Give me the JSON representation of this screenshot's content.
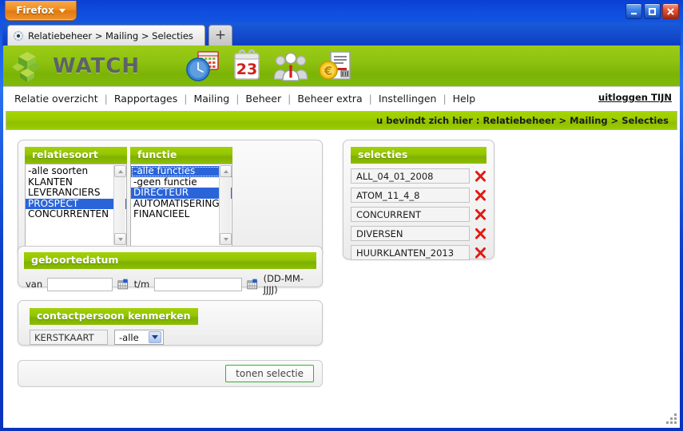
{
  "window": {
    "firefox_button": "Firefox",
    "minimize_label": "Minimize",
    "maximize_label": "Maximize",
    "close_label": "Close"
  },
  "browser": {
    "tab_title": "Relatiebeheer > Mailing > Selecties",
    "new_tab_label": "+"
  },
  "site": {
    "logo_text": "WATCH",
    "header_icons": [
      {
        "name": "clock-calendar-icon"
      },
      {
        "name": "calendar-23-icon"
      },
      {
        "name": "people-group-icon"
      },
      {
        "name": "euro-invoice-icon"
      }
    ]
  },
  "nav": {
    "items": [
      "Relatie overzicht",
      "Rapportages",
      "Mailing",
      "Beheer",
      "Beheer extra",
      "Instellingen",
      "Help"
    ],
    "separator": "|",
    "logout": "uitloggen TIJN"
  },
  "breadcrumb": {
    "text": "u bevindt zich hier : Relatiebeheer > Mailing > Selecties"
  },
  "filters": {
    "relatiesoort": {
      "title": "relatiesoort",
      "options": [
        {
          "label": "-alle soorten",
          "selected": false
        },
        {
          "label": "KLANTEN",
          "selected": false
        },
        {
          "label": "LEVERANCIERS",
          "selected": false
        },
        {
          "label": "PROSPECT",
          "selected": true
        },
        {
          "label": "CONCURRENTEN",
          "selected": false
        }
      ]
    },
    "functie": {
      "title": "functie",
      "options": [
        {
          "label": "-alle functies",
          "selected": true,
          "focused": true
        },
        {
          "label": "-geen functie",
          "selected": false
        },
        {
          "label": "DIRECTEUR",
          "selected": true
        },
        {
          "label": "AUTOMATISERING",
          "selected": false
        },
        {
          "label": "FINANCIEEL",
          "selected": false
        }
      ]
    },
    "geboortedatum": {
      "title": "geboortedatum",
      "from_label": "van",
      "from_value": "",
      "from_placeholder": "",
      "to_label": "t/m",
      "to_value": "",
      "to_placeholder": "",
      "format_hint": "(DD-MM-JJJJ)"
    },
    "contactpersoon": {
      "title": "contactpersoon kenmerken",
      "kenmerk": "KERSTKAART",
      "selected_option": "-alle",
      "options": [
        "-alle"
      ]
    }
  },
  "actions": {
    "tonen_selectie": "tonen selectie"
  },
  "selecties": {
    "title": "selecties",
    "items": [
      {
        "name": "ALL_04_01_2008",
        "delete": "delete-x-icon"
      },
      {
        "name": "ATOM_11_4_8",
        "delete": "delete-x-icon"
      },
      {
        "name": "CONCURRENT",
        "delete": "delete-x-icon"
      },
      {
        "name": "DIVERSEN",
        "delete": "delete-x-icon"
      },
      {
        "name": "HUURKLANTEN_2013",
        "delete": "delete-x-icon"
      }
    ]
  },
  "colors": {
    "brand_green": "#9bcc16",
    "band_green": "#9ccc00",
    "selection_blue": "#2a64d8",
    "delete_red": "#e01b12",
    "chrome_blue": "#0b3fd4",
    "firefox_orange": "#ef8e22"
  }
}
